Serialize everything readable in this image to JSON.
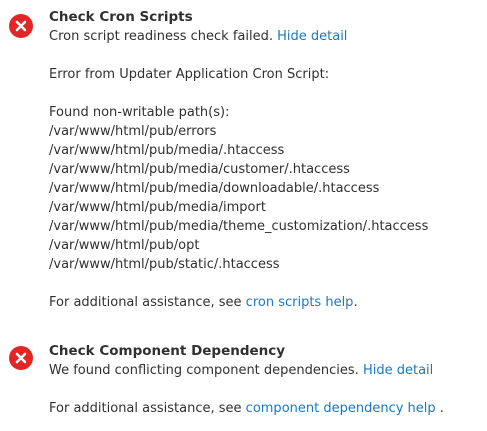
{
  "cron_check": {
    "title": "Check Cron Scripts",
    "message": "Cron script readiness check failed.",
    "hide_detail": "Hide detail",
    "error_source": "Error from Updater Application Cron Script:",
    "paths_heading": "Found non-writable path(s):",
    "paths": [
      "/var/www/html/pub/errors",
      "/var/www/html/pub/media/.htaccess",
      "/var/www/html/pub/media/customer/.htaccess",
      "/var/www/html/pub/media/downloadable/.htaccess",
      "/var/www/html/pub/media/import",
      "/var/www/html/pub/media/theme_customization/.htaccess",
      "/var/www/html/pub/opt",
      "/var/www/html/pub/static/.htaccess"
    ],
    "assistance_prefix": "For additional assistance, see",
    "help_link": "cron scripts help",
    "assistance_suffix": "."
  },
  "dependency_check": {
    "title": "Check Component Dependency",
    "message": "We found conflicting component dependencies.",
    "hide_detail": "Hide detail",
    "assistance_prefix": "For additional assistance, see",
    "help_link": "component dependency help",
    "assistance_suffix": "."
  },
  "colors": {
    "error_icon": "#e22626",
    "link": "#1979c3",
    "text": "#303030"
  },
  "icons": {
    "status": "error-x-circle-icon"
  }
}
